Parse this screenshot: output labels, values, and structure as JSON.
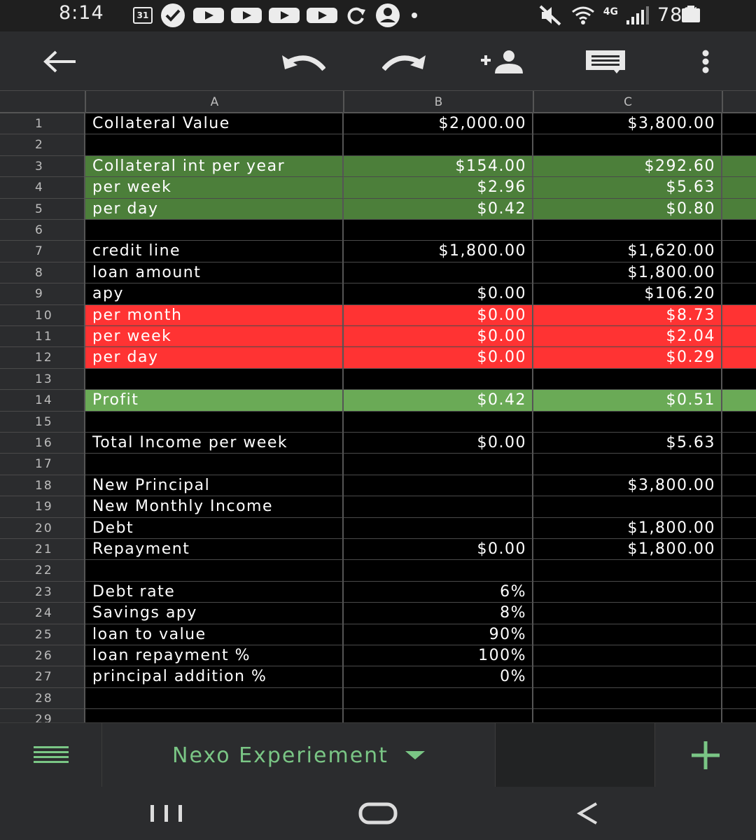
{
  "status_bar": {
    "time": "8:14",
    "calendar_day": "31",
    "network": "4G",
    "battery": "78%"
  },
  "toolbar": {
    "icons": [
      "back-arrow-icon",
      "undo-icon",
      "redo-icon",
      "add-person-icon",
      "comment-icon",
      "more-vert-icon"
    ]
  },
  "columns": [
    "A",
    "B",
    "C"
  ],
  "rows": [
    {
      "num": "1",
      "a": "Collateral Value",
      "b": "$2,000.00",
      "c": "$3,800.00",
      "fill": ""
    },
    {
      "num": "2",
      "a": "",
      "b": "",
      "c": "",
      "fill": ""
    },
    {
      "num": "3",
      "a": "Collateral int per year",
      "b": "$154.00",
      "c": "$292.60",
      "fill": "green"
    },
    {
      "num": "4",
      "a": "per week",
      "b": "$2.96",
      "c": "$5.63",
      "fill": "green"
    },
    {
      "num": "5",
      "a": "per day",
      "b": "$0.42",
      "c": "$0.80",
      "fill": "green"
    },
    {
      "num": "6",
      "a": "",
      "b": "",
      "c": "",
      "fill": ""
    },
    {
      "num": "7",
      "a": "credit line",
      "b": "$1,800.00",
      "c": "$1,620.00",
      "fill": ""
    },
    {
      "num": "8",
      "a": "loan amount",
      "b": "",
      "c": "$1,800.00",
      "fill": ""
    },
    {
      "num": "9",
      "a": "apy",
      "b": "$0.00",
      "c": "$106.20",
      "fill": ""
    },
    {
      "num": "10",
      "a": "per month",
      "b": "$0.00",
      "c": "$8.73",
      "fill": "red"
    },
    {
      "num": "11",
      "a": "per week",
      "b": "$0.00",
      "c": "$2.04",
      "fill": "red"
    },
    {
      "num": "12",
      "a": "per day",
      "b": "$0.00",
      "c": "$0.29",
      "fill": "red"
    },
    {
      "num": "13",
      "a": "",
      "b": "",
      "c": "",
      "fill": ""
    },
    {
      "num": "14",
      "a": "Profit",
      "b": "$0.42",
      "c": "$0.51",
      "fill": "lgreen"
    },
    {
      "num": "15",
      "a": "",
      "b": "",
      "c": "",
      "fill": ""
    },
    {
      "num": "16",
      "a": "Total Income per week",
      "b": "$0.00",
      "c": "$5.63",
      "fill": ""
    },
    {
      "num": "17",
      "a": "",
      "b": "",
      "c": "",
      "fill": ""
    },
    {
      "num": "18",
      "a": "New Principal",
      "b": "",
      "c": "$3,800.00",
      "fill": ""
    },
    {
      "num": "19",
      "a": "New Monthly Income",
      "b": "",
      "c": "",
      "fill": ""
    },
    {
      "num": "20",
      "a": "Debt",
      "b": "",
      "c": "$1,800.00",
      "fill": ""
    },
    {
      "num": "21",
      "a": "Repayment",
      "b": "$0.00",
      "c": "$1,800.00",
      "fill": ""
    },
    {
      "num": "22",
      "a": "",
      "b": "",
      "c": "",
      "fill": ""
    },
    {
      "num": "23",
      "a": "Debt rate",
      "b": "6%",
      "c": "",
      "fill": ""
    },
    {
      "num": "24",
      "a": "Savings apy",
      "b": "8%",
      "c": "",
      "fill": ""
    },
    {
      "num": "25",
      "a": "loan to value",
      "b": "90%",
      "c": "",
      "fill": ""
    },
    {
      "num": "26",
      "a": "loan repayment %",
      "b": "100%",
      "c": "",
      "fill": ""
    },
    {
      "num": "27",
      "a": "principal addition %",
      "b": "0%",
      "c": "",
      "fill": ""
    },
    {
      "num": "28",
      "a": "",
      "b": "",
      "c": "",
      "fill": ""
    },
    {
      "num": "29",
      "a": "",
      "b": "",
      "c": "",
      "fill": ""
    }
  ],
  "sheet_tab": {
    "name": "Nexo Experiement"
  },
  "colors": {
    "green": "#4c7f3a",
    "red": "#ff3333",
    "light_green": "#6aaa56",
    "accent": "#7ac685"
  }
}
